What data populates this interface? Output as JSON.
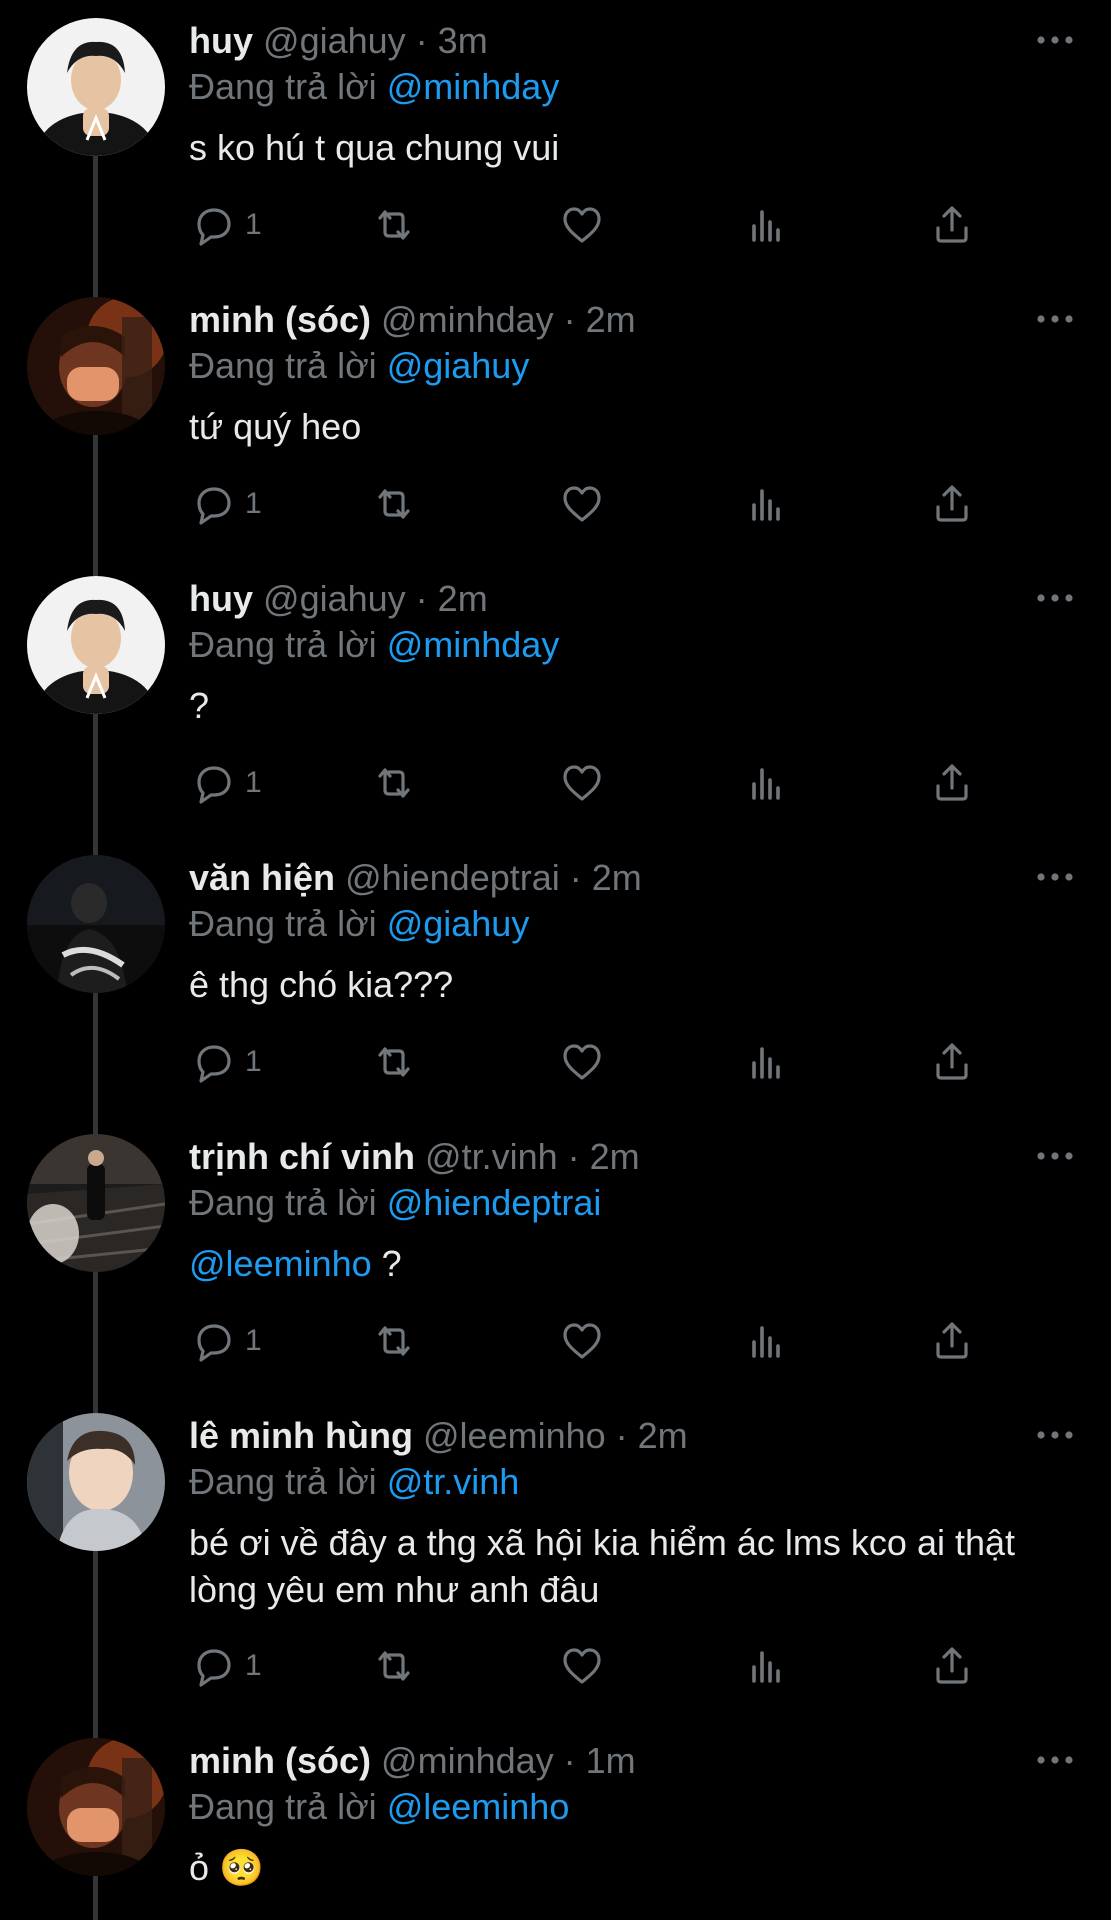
{
  "colors": {
    "background": "#000000",
    "text": "#e7e9ea",
    "secondary": "#71767b",
    "accent": "#1d9bf0",
    "thread_line": "#333639"
  },
  "labels": {
    "replying_to": "Đang trả lời"
  },
  "icons": {
    "more": "more-horizontal-icon",
    "reply": "reply-icon",
    "retweet": "retweet-icon",
    "like": "heart-icon",
    "views": "views-chart-icon",
    "share": "share-icon"
  },
  "tweets": [
    {
      "name": "huy",
      "handle": "@giahuy",
      "time": "3m",
      "reply_to": "@minhday",
      "text_mention": "",
      "text": "s ko hú t qua chung vui",
      "reply_count": "1",
      "avatar": "huy-avatar"
    },
    {
      "name": "minh (sóc)",
      "handle": "@minhday",
      "time": "2m",
      "reply_to": "@giahuy",
      "text_mention": "",
      "text": "tứ quý heo",
      "reply_count": "1",
      "avatar": "minh-avatar"
    },
    {
      "name": "huy",
      "handle": "@giahuy",
      "time": "2m",
      "reply_to": "@minhday",
      "text_mention": "",
      "text": "?",
      "reply_count": "1",
      "avatar": "huy-avatar"
    },
    {
      "name": "văn hiện",
      "handle": "@hiendeptrai",
      "time": "2m",
      "reply_to": "@giahuy",
      "text_mention": "",
      "text": "ê thg chó kia???",
      "reply_count": "1",
      "avatar": "hien-avatar"
    },
    {
      "name": "trịnh chí vinh",
      "handle": "@tr.vinh",
      "time": "2m",
      "reply_to": "@hiendeptrai",
      "text_mention": "@leeminho",
      "text": " ?",
      "reply_count": "1",
      "avatar": "vinh-avatar"
    },
    {
      "name": "lê minh hùng",
      "handle": "@leeminho",
      "time": "2m",
      "reply_to": "@tr.vinh",
      "text_mention": "",
      "text": "bé ơi về đây a thg xã hội kia hiểm ác lms kco ai thật lòng yêu em như anh đâu",
      "reply_count": "1",
      "avatar": "hung-avatar"
    },
    {
      "name": "minh (sóc)",
      "handle": "@minhday",
      "time": "1m",
      "reply_to": "@leeminho",
      "text_mention": "",
      "text": "ỏ 🥺",
      "reply_count": "",
      "avatar": "minh-avatar"
    }
  ]
}
